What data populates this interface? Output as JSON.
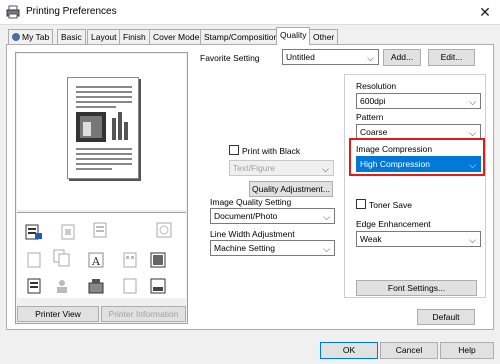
{
  "window": {
    "title": "Printing Preferences"
  },
  "tabs": [
    "My Tab",
    "Basic",
    "Layout",
    "Finish",
    "Cover Mode",
    "Stamp/Composition",
    "Quality",
    "Other"
  ],
  "favorite": {
    "label": "Favorite Setting",
    "value": "Untitled",
    "add_label": "Add...",
    "edit_label": "Edit..."
  },
  "preview": {
    "printer_view_label": "Printer View",
    "printer_info_label": "Printer Information"
  },
  "quality": {
    "print_with_black_label": "Print with Black",
    "text_figure_value": "Text/Figure",
    "quality_adjustment_label": "Quality Adjustment...",
    "image_quality_label": "Image Quality Setting",
    "image_quality_value": "Document/Photo",
    "line_width_label": "Line Width Adjustment",
    "line_width_value": "Machine Setting"
  },
  "right": {
    "resolution_label": "Resolution",
    "resolution_value": "600dpi",
    "pattern_label": "Pattern",
    "pattern_value": "Coarse",
    "image_compression_label": "Image Compression",
    "image_compression_value": "High Compression",
    "toner_save_label": "Toner Save",
    "edge_enhancement_label": "Edge Enhancement",
    "edge_enhancement_value": "Weak",
    "font_settings_label": "Font Settings..."
  },
  "footer": {
    "default_label": "Default",
    "ok_label": "OK",
    "cancel_label": "Cancel",
    "help_label": "Help"
  },
  "colors": {
    "highlight": "#e21a1a",
    "selection": "#0078d7"
  }
}
